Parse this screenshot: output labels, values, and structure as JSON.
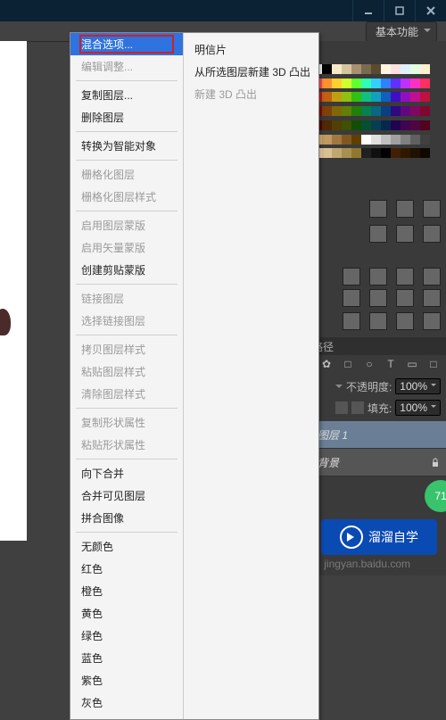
{
  "window": {
    "workspace": "基本功能"
  },
  "menu": {
    "left": [
      {
        "k": "blend",
        "t": "混合选项...",
        "sel": true,
        "red": true
      },
      {
        "k": "editadj",
        "t": "编辑调整...",
        "dis": true
      },
      {
        "sep": true
      },
      {
        "k": "dup",
        "t": "复制图层..."
      },
      {
        "k": "del",
        "t": "删除图层"
      },
      {
        "sep": true
      },
      {
        "k": "smart",
        "t": "转换为智能对象"
      },
      {
        "sep": true
      },
      {
        "k": "rasterlayer",
        "t": "栅格化图层",
        "dis": true
      },
      {
        "k": "rasterstyle",
        "t": "栅格化图层样式",
        "dis": true
      },
      {
        "sep": true
      },
      {
        "k": "enmask",
        "t": "启用图层蒙版",
        "dis": true
      },
      {
        "k": "envmask",
        "t": "启用矢量蒙版",
        "dis": true
      },
      {
        "k": "clip",
        "t": "创建剪贴蒙版"
      },
      {
        "sep": true
      },
      {
        "k": "link",
        "t": "链接图层",
        "dis": true
      },
      {
        "k": "sellink",
        "t": "选择链接图层",
        "dis": true
      },
      {
        "sep": true
      },
      {
        "k": "copyst",
        "t": "拷贝图层样式",
        "dis": true
      },
      {
        "k": "pastest",
        "t": "粘贴图层样式",
        "dis": true
      },
      {
        "k": "clearst",
        "t": "清除图层样式",
        "dis": true
      },
      {
        "sep": true
      },
      {
        "k": "copyshape",
        "t": "复制形状属性",
        "dis": true
      },
      {
        "k": "pasteshape",
        "t": "粘贴形状属性",
        "dis": true
      },
      {
        "sep": true
      },
      {
        "k": "mergedown",
        "t": "向下合并"
      },
      {
        "k": "mergevis",
        "t": "合并可见图层"
      },
      {
        "k": "flatten",
        "t": "拼合图像"
      },
      {
        "sep": true
      },
      {
        "k": "nocolor",
        "t": "无颜色"
      },
      {
        "k": "red",
        "t": "红色"
      },
      {
        "k": "orange",
        "t": "橙色"
      },
      {
        "k": "yellow",
        "t": "黄色"
      },
      {
        "k": "green",
        "t": "绿色"
      },
      {
        "k": "blue",
        "t": "蓝色"
      },
      {
        "k": "violet",
        "t": "紫色"
      },
      {
        "k": "gray",
        "t": "灰色"
      }
    ],
    "right": [
      {
        "k": "postcard",
        "t": "明信片"
      },
      {
        "k": "extrude",
        "t": "从所选图层新建 3D 凸出"
      },
      {
        "k": "new3d",
        "t": "新建 3D 凸出",
        "dis": true
      }
    ]
  },
  "panels": {
    "tab_path": "路径",
    "opacity_label": "不透明度:",
    "opacity_val": "100%",
    "fill_label": "填充:",
    "fill_val": "100%",
    "layer1": "图层 1",
    "bg": "背景"
  },
  "badge": "71",
  "brand": "溜溜自学",
  "watermark": "jingyan.baidu.com",
  "swatch_colors": [
    "#ffffff",
    "#000000",
    "#f7e8c7",
    "#d4c4a0",
    "#a89070",
    "#7a6a50",
    "#5a4a30",
    "#fff5e0",
    "#ffe0e0",
    "#e0f0ff",
    "#e0ffe0",
    "#fff0d0",
    "#ff5050",
    "#ff9030",
    "#ffd030",
    "#d0ff30",
    "#60ff30",
    "#30ffb0",
    "#30d0ff",
    "#3080ff",
    "#6030ff",
    "#c030ff",
    "#ff30c0",
    "#ff3060",
    "#c02020",
    "#c06010",
    "#c0a010",
    "#90c010",
    "#30c010",
    "#10c080",
    "#10a0c0",
    "#1060c0",
    "#4010c0",
    "#9010c0",
    "#c01090",
    "#c01040",
    "#801010",
    "#804008",
    "#806808",
    "#608008",
    "#208008",
    "#088050",
    "#086880",
    "#084080",
    "#300880",
    "#600880",
    "#800860",
    "#800830",
    "#500808",
    "#502804",
    "#504004",
    "#405004",
    "#105004",
    "#045030",
    "#044050",
    "#042850",
    "#200450",
    "#400450",
    "#500440",
    "#500420",
    "#d8b480",
    "#c09860",
    "#a07840",
    "#805820",
    "#604000",
    "#ffffff",
    "#e0e0e0",
    "#c0c0c0",
    "#a0a0a0",
    "#808080",
    "#606060",
    "#404040",
    "#f0d8b0",
    "#d8c090",
    "#c0a870",
    "#a89050",
    "#907830",
    "#202020",
    "#101010",
    "#000000",
    "#402000",
    "#301800",
    "#201000",
    "#100800"
  ],
  "type_icons": [
    "✿",
    "□",
    "○",
    "T",
    "▭",
    "□"
  ]
}
